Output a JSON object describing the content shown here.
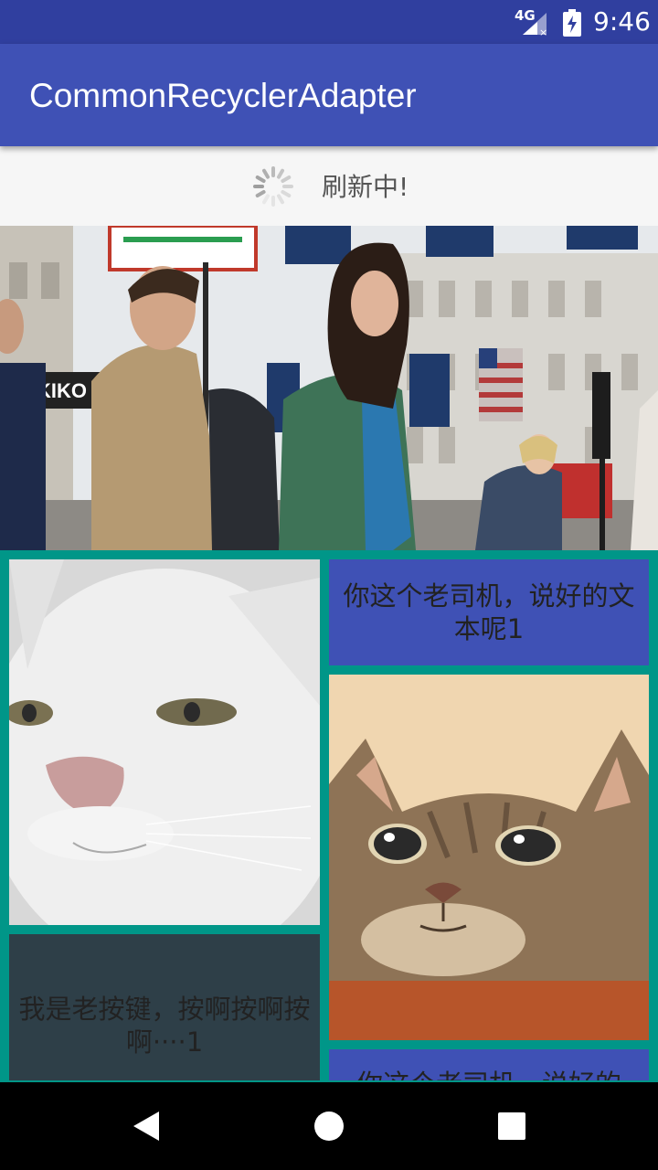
{
  "status_bar": {
    "network_label": "4G",
    "time": "9:46",
    "icons": [
      "signal-icon",
      "battery-charging-icon"
    ]
  },
  "app_bar": {
    "title": "CommonRecyclerAdapter",
    "color": "#3F51B5"
  },
  "refresh_header": {
    "icon": "loading-spinner-icon",
    "text": "刷新中!"
  },
  "banner": {
    "image": "street-photo"
  },
  "grid": {
    "background_color": "#009688",
    "items": [
      {
        "type": "image",
        "image": "white-cat-photo"
      },
      {
        "type": "text",
        "text": "你这个老司机，说好的文本呢1",
        "background": "#3F51B5"
      },
      {
        "type": "image",
        "image": "tabby-cat-photo"
      },
      {
        "type": "text",
        "text": "我是老按键，按啊按啊按啊····1",
        "background": "#2E3F48"
      },
      {
        "type": "text",
        "text": "你这个老司机，说好的",
        "background": "#3F51B5"
      }
    ]
  },
  "nav_bar": {
    "buttons": [
      "back-icon",
      "home-icon",
      "recents-icon"
    ]
  }
}
